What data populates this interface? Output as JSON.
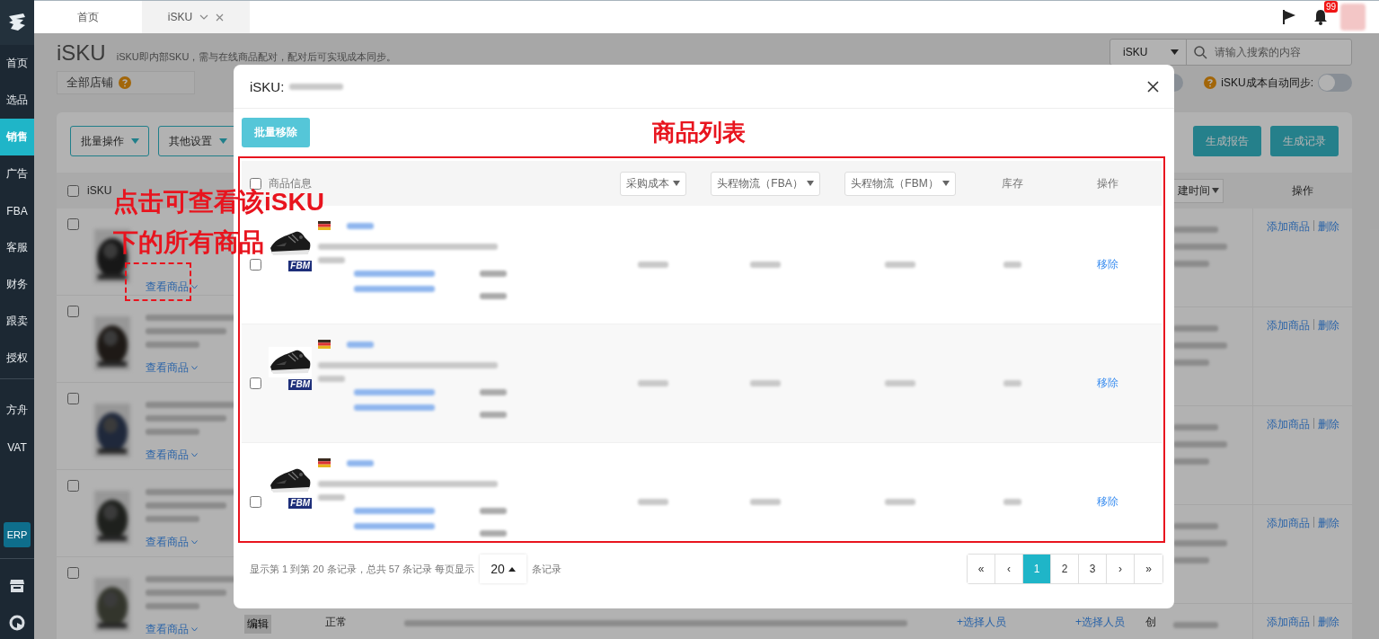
{
  "sidebar": {
    "groups": [
      [
        {
          "label": "首页",
          "selected": false
        },
        {
          "label": "选品",
          "selected": false
        },
        {
          "label": "销售",
          "selected": true
        },
        {
          "label": "广告",
          "selected": false
        },
        {
          "label": "FBA",
          "selected": false
        },
        {
          "label": "客服",
          "selected": false
        },
        {
          "label": "财务",
          "selected": false
        },
        {
          "label": "跟卖",
          "selected": false
        },
        {
          "label": "授权",
          "selected": false
        }
      ],
      [
        {
          "label": "方舟",
          "selected": false
        },
        {
          "label": "VAT",
          "selected": false
        }
      ]
    ],
    "badge": "ERP"
  },
  "tabs": [
    {
      "label": "首页",
      "selected": false,
      "closable": false
    },
    {
      "label": "iSKU",
      "selected": true,
      "closable": true
    }
  ],
  "notification_badge": "99",
  "page": {
    "title": "iSKU",
    "description": "iSKU即内部SKU，需与在线商品配对，配对后可实现成本同步。",
    "store_filter": "全部店铺",
    "search": {
      "field": "iSKU",
      "placeholder": "请输入搜索的内容"
    },
    "cost_toggle": {
      "on": false
    },
    "auto_sync": {
      "label": "iSKU成本自动同步:",
      "on": false
    },
    "menus": [
      "批量操作",
      "其他设置"
    ],
    "actions": [
      "生成报告",
      "生成记录"
    ],
    "table": {
      "select_all": false,
      "columns": {
        "info": "iSKU",
        "sort": "建时间",
        "actions": "操作"
      },
      "rows": [
        {
          "checked": false,
          "link": "查看商品",
          "actions": [
            "添加商品",
            "删除"
          ]
        },
        {
          "checked": false,
          "link": "查看商品",
          "actions": [
            "添加商品",
            "删除"
          ]
        },
        {
          "checked": false,
          "link": "查看商品",
          "actions": [
            "添加商品",
            "删除"
          ]
        },
        {
          "checked": false,
          "link": "查看商品",
          "actions": [
            "添加商品",
            "删除"
          ]
        },
        {
          "checked": false,
          "link": "查看商品",
          "actions": [
            "添加商品",
            "删除"
          ],
          "cells": [
            {
              "kind": "button",
              "text": "编辑"
            },
            {
              "kind": "text",
              "text": "正常"
            },
            {
              "kind": "link",
              "text": "+选择人员"
            },
            {
              "kind": "link",
              "text": "+选择人员"
            },
            {
              "kind": "text",
              "text": "创"
            }
          ]
        }
      ]
    }
  },
  "modal": {
    "title": "iSKU:",
    "bulk_remove": "批量移除",
    "select_all": false,
    "columns": [
      {
        "label": "商品信息",
        "kind": "text"
      },
      {
        "label": "采购成本",
        "kind": "sort"
      },
      {
        "label": "头程物流（FBA）",
        "kind": "sort"
      },
      {
        "label": "头程物流（FBM）",
        "kind": "sort"
      },
      {
        "label": "库存",
        "kind": "text"
      },
      {
        "label": "操作",
        "kind": "text"
      }
    ],
    "rows": [
      {
        "checked": false,
        "badge": "FBM",
        "action": "移除"
      },
      {
        "checked": false,
        "badge": "FBM",
        "action": "移除"
      },
      {
        "checked": false,
        "badge": "FBM",
        "action": "移除"
      }
    ],
    "footer": {
      "summary": "显示第 1 到第 20 条记录，总共 57 条记录 每页显示",
      "page_size": "20",
      "suffix": "条记录"
    },
    "pagination": {
      "first": "«",
      "prev": "‹",
      "pages": [
        {
          "label": "1",
          "selected": true
        },
        {
          "label": "2",
          "selected": false
        },
        {
          "label": "3",
          "selected": false
        }
      ],
      "next": "›",
      "last": "»"
    }
  },
  "annotations": {
    "callout": [
      "点击可查看该iSKU",
      "下的所有商品"
    ],
    "heading": "商品列表"
  }
}
